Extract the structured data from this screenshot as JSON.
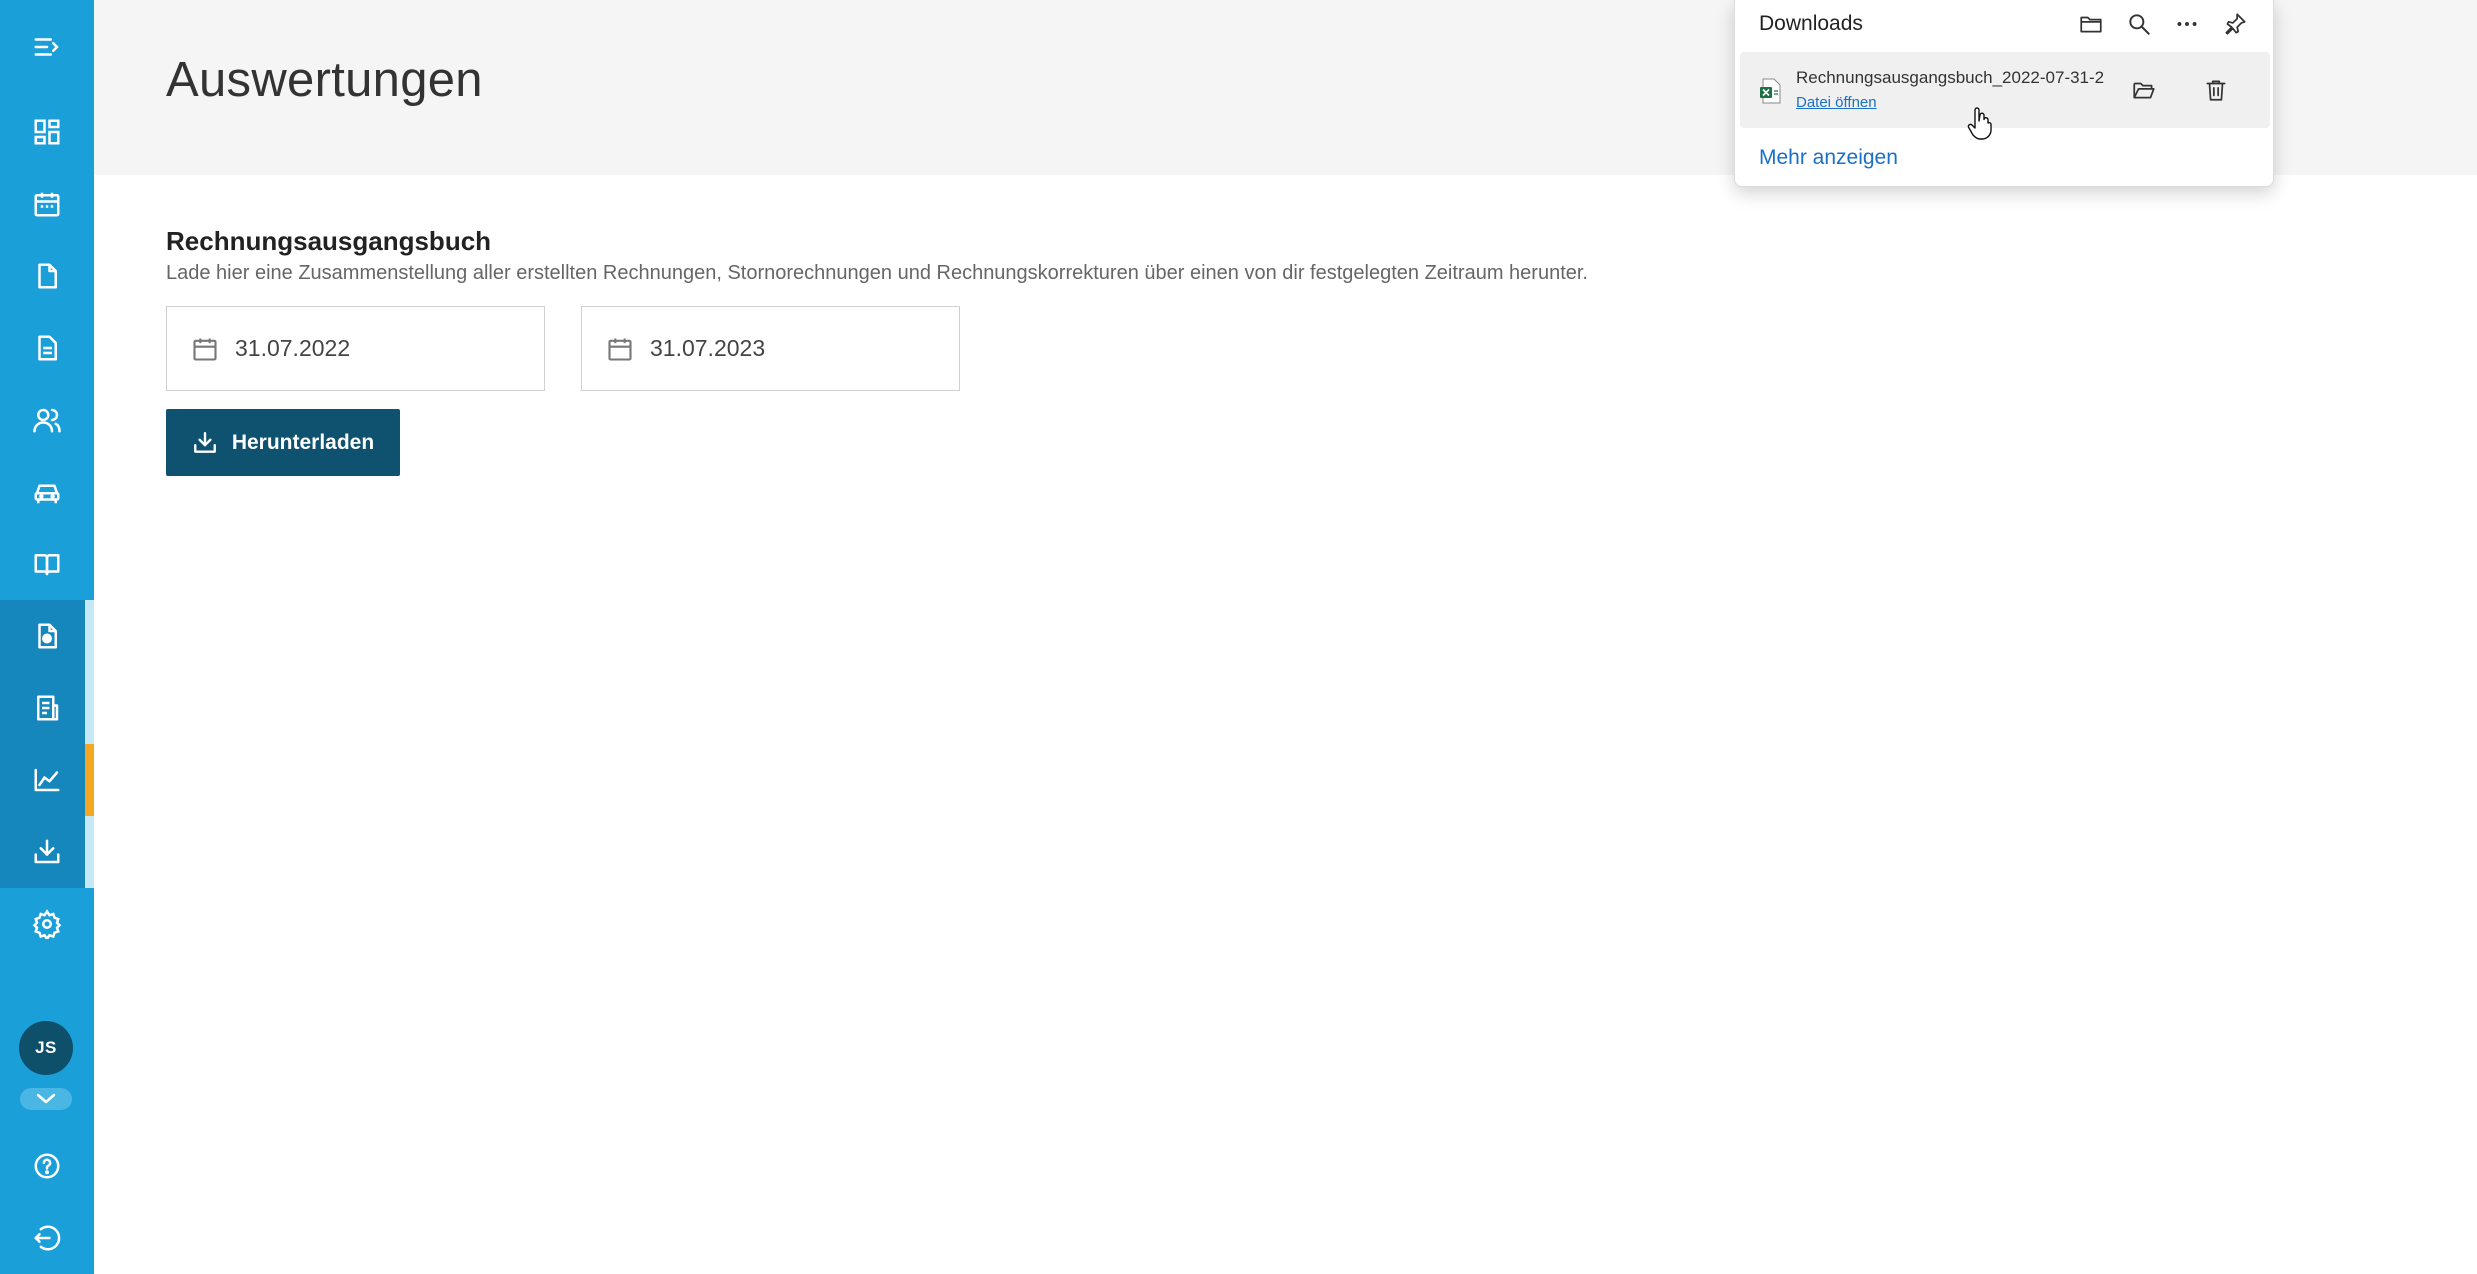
{
  "sidebar": {
    "items": [
      {
        "name": "menu-toggle",
        "icon": "menu-collapse-icon"
      },
      {
        "name": "dashboard",
        "icon": "dashboard-icon"
      },
      {
        "name": "calendar",
        "icon": "calendar-icon"
      },
      {
        "name": "documents",
        "icon": "document-icon"
      },
      {
        "name": "invoices",
        "icon": "invoice-list-icon"
      },
      {
        "name": "customers",
        "icon": "users-icon"
      },
      {
        "name": "vehicles",
        "icon": "car-icon"
      },
      {
        "name": "handbook",
        "icon": "book-icon"
      },
      {
        "name": "receipts",
        "icon": "receipt-check-icon"
      },
      {
        "name": "reports",
        "icon": "report-list-icon"
      },
      {
        "name": "evaluations",
        "icon": "chart-line-icon"
      },
      {
        "name": "downloads",
        "icon": "download-tray-icon"
      },
      {
        "name": "settings",
        "icon": "gear-icon"
      }
    ],
    "user": {
      "initials": "JS"
    },
    "bottom": [
      {
        "name": "help",
        "icon": "help-icon"
      },
      {
        "name": "logout",
        "icon": "logout-icon"
      }
    ],
    "colors": {
      "background": "#1a9fd9",
      "active_marker": "#f5a623"
    }
  },
  "header": {
    "title": "Auswertungen"
  },
  "section": {
    "title": "Rechnungsausgangsbuch",
    "description": "Lade hier eine Zusammenstellung aller erstellten Rechnungen, Stornorechnungen und Rechnungskorrekturen über einen von dir festgelegten Zeitraum herunter.",
    "date_from": "31.07.2022",
    "date_to": "31.07.2023",
    "download_label": "Herunterladen",
    "button_color": "#0e5270"
  },
  "downloads_panel": {
    "title": "Downloads",
    "item": {
      "file_name": "Rechnungsausgangsbuch_2022-07-31-2",
      "open_label": "Datei öffnen",
      "file_icon": "excel-file-icon"
    },
    "more_label": "Mehr anzeigen",
    "link_color": "#1a6fc9"
  }
}
